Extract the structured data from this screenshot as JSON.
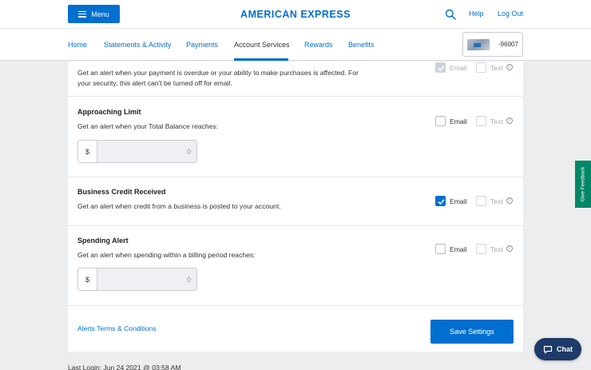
{
  "header": {
    "menu_label": "Menu",
    "brand": "AMERICAN EXPRESS",
    "help": "Help",
    "logout": "Log Out",
    "accent_color": "#006fcf"
  },
  "nav": {
    "tabs": [
      "Home",
      "Statements & Activity",
      "Payments",
      "Account Services",
      "Rewards",
      "Benefits"
    ],
    "active_tab": "Account Services",
    "card_number": "-96007"
  },
  "alerts": [
    {
      "title": "",
      "description": "Get an alert when your payment is overdue or your ability to make purchases is affected. For your security, this alert can't be turned off for email.",
      "email_label": "Email",
      "email_state": "checked-disabled",
      "text_label": "Text",
      "text_state": "disabled"
    },
    {
      "title": "Approaching Limit",
      "description": "Get an alert when your Total Balance reaches:",
      "currency": "$",
      "amount_placeholder": "0",
      "email_label": "Email",
      "email_state": "unchecked",
      "text_label": "Text",
      "text_state": "disabled"
    },
    {
      "title": "Business Credit Received",
      "description": "Get an alert when credit from a business is posted to your account.",
      "email_label": "Email",
      "email_state": "checked",
      "text_label": "Text",
      "text_state": "disabled"
    },
    {
      "title": "Spending Alert",
      "description": "Get an alert when spending within a billing period reaches:",
      "currency": "$",
      "amount_placeholder": "0",
      "email_label": "Email",
      "email_state": "unchecked",
      "text_label": "Text",
      "text_state": "disabled"
    }
  ],
  "footer": {
    "terms": "Alerts Terms & Conditions",
    "save": "Save Settings"
  },
  "feedback_label": "Give Feedback",
  "chat_label": "Chat",
  "bottom_text": "Last Login: Jun 24 2021 @ 03:58 AM",
  "icons": [
    "menu-icon",
    "search-icon",
    "checkmark-icon",
    "info-icon",
    "chat-icon"
  ]
}
